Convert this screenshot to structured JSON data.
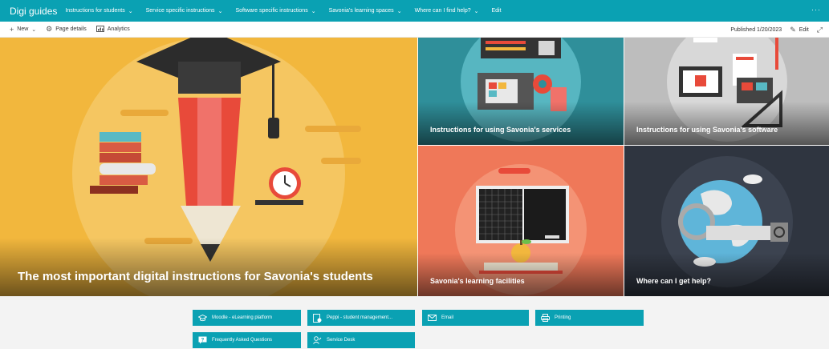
{
  "topnav": {
    "site_title": "Digi guides",
    "items": [
      {
        "label": "Instructions for students"
      },
      {
        "label": "Service specific instructions"
      },
      {
        "label": "Software specific instructions"
      },
      {
        "label": "Savonia's learning spaces"
      },
      {
        "label": "Where can I find help?"
      }
    ],
    "edit_label": "Edit",
    "more_label": "···"
  },
  "commandbar": {
    "new_label": "New",
    "page_details_label": "Page details",
    "analytics_label": "Analytics",
    "published_label": "Published 1/20/2023",
    "edit_label": "Edit"
  },
  "hero": {
    "main_title": "The most important digital instructions for Savonia's students",
    "tiles": [
      {
        "title": "Instructions for using Savonia's services"
      },
      {
        "title": "Instructions for using Savonia's software"
      },
      {
        "title": "Savonia's learning facilities"
      },
      {
        "title": "Where can I get help?"
      }
    ]
  },
  "quicklinks": [
    {
      "label": "Moodle - eLearning platform",
      "icon": "graduation-cap-icon"
    },
    {
      "label": "Peppi - student management...",
      "icon": "peppi-app-icon"
    },
    {
      "label": "Email",
      "icon": "mail-icon"
    },
    {
      "label": "Printing",
      "icon": "printer-icon"
    },
    {
      "label": "Frequently Asked Questions",
      "icon": "faq-icon"
    },
    {
      "label": "Service Desk",
      "icon": "service-desk-icon"
    }
  ],
  "colors": {
    "accent": "#0aa1b3",
    "main_tile": "#f2b73d",
    "services_tile": "#2f8f9a",
    "software_tile": "#bdbdbd",
    "facilities_tile": "#ef7859",
    "help_tile": "#2f3540"
  }
}
